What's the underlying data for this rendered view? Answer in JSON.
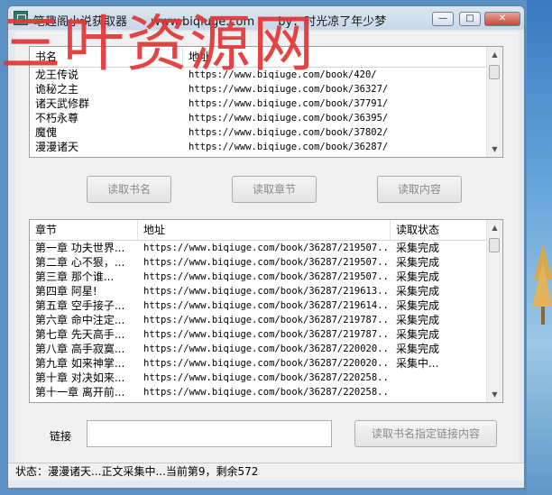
{
  "window": {
    "title": "笔趣阁小说获取器",
    "site": "www.biqiuge.com",
    "credit": "by：时光凉了年少梦",
    "min_glyph": "—",
    "max_glyph": "□",
    "close_glyph": "✕"
  },
  "watermark": "三叶资源网",
  "books_table": {
    "columns": [
      "书名",
      "地址"
    ],
    "rows": [
      {
        "name": "龙王传说",
        "url": "https://www.biqiuge.com/book/420/"
      },
      {
        "name": "诡秘之主",
        "url": "https://www.biqiuge.com/book/36327/"
      },
      {
        "name": "诸天武修群",
        "url": "https://www.biqiuge.com/book/37791/"
      },
      {
        "name": "不朽永尊",
        "url": "https://www.biqiuge.com/book/36395/"
      },
      {
        "name": "魔傀",
        "url": "https://www.biqiuge.com/book/37802/"
      },
      {
        "name": "漫漫诸天",
        "url": "https://www.biqiuge.com/book/36287/"
      }
    ]
  },
  "buttons": {
    "read_books": "读取书名",
    "read_chapters": "读取章节",
    "read_content": "读取内容",
    "read_by_link": "读取书名指定链接内容"
  },
  "chapters_table": {
    "columns": [
      "章节",
      "地址",
      "读取状态"
    ],
    "rows": [
      {
        "chapter": "第一章 功夫世界...",
        "url": "https://www.biqiuge.com/book/36287/219507...",
        "status": "采集完成"
      },
      {
        "chapter": "第二章 心不狠，...",
        "url": "https://www.biqiuge.com/book/36287/219507...",
        "status": "采集完成"
      },
      {
        "chapter": "第三章 那个谁...",
        "url": "https://www.biqiuge.com/book/36287/219507...",
        "status": "采集完成"
      },
      {
        "chapter": "第四章 阿星!",
        "url": "https://www.biqiuge.com/book/36287/219613...",
        "status": "采集完成"
      },
      {
        "chapter": "第五章 空手接子...",
        "url": "https://www.biqiuge.com/book/36287/219614...",
        "status": "采集完成"
      },
      {
        "chapter": "第六章 命中注定...",
        "url": "https://www.biqiuge.com/book/36287/219787...",
        "status": "采集完成"
      },
      {
        "chapter": "第七章 先天高手...",
        "url": "https://www.biqiuge.com/book/36287/219787...",
        "status": "采集完成"
      },
      {
        "chapter": "第八章 高手寂寞...",
        "url": "https://www.biqiuge.com/book/36287/220020...",
        "status": "采集完成"
      },
      {
        "chapter": "第九章 如来神掌...",
        "url": "https://www.biqiuge.com/book/36287/220020...",
        "status": "采集中..."
      },
      {
        "chapter": "第十章 对决如来...",
        "url": "https://www.biqiuge.com/book/36287/220258...",
        "status": ""
      },
      {
        "chapter": "第十一章 离开前...",
        "url": "https://www.biqiuge.com/book/36287/220258...",
        "status": ""
      }
    ]
  },
  "link": {
    "label": "链接",
    "value": ""
  },
  "status": {
    "text": "状态：漫漫诸天...正文采集中...当前第9，剩余572"
  }
}
